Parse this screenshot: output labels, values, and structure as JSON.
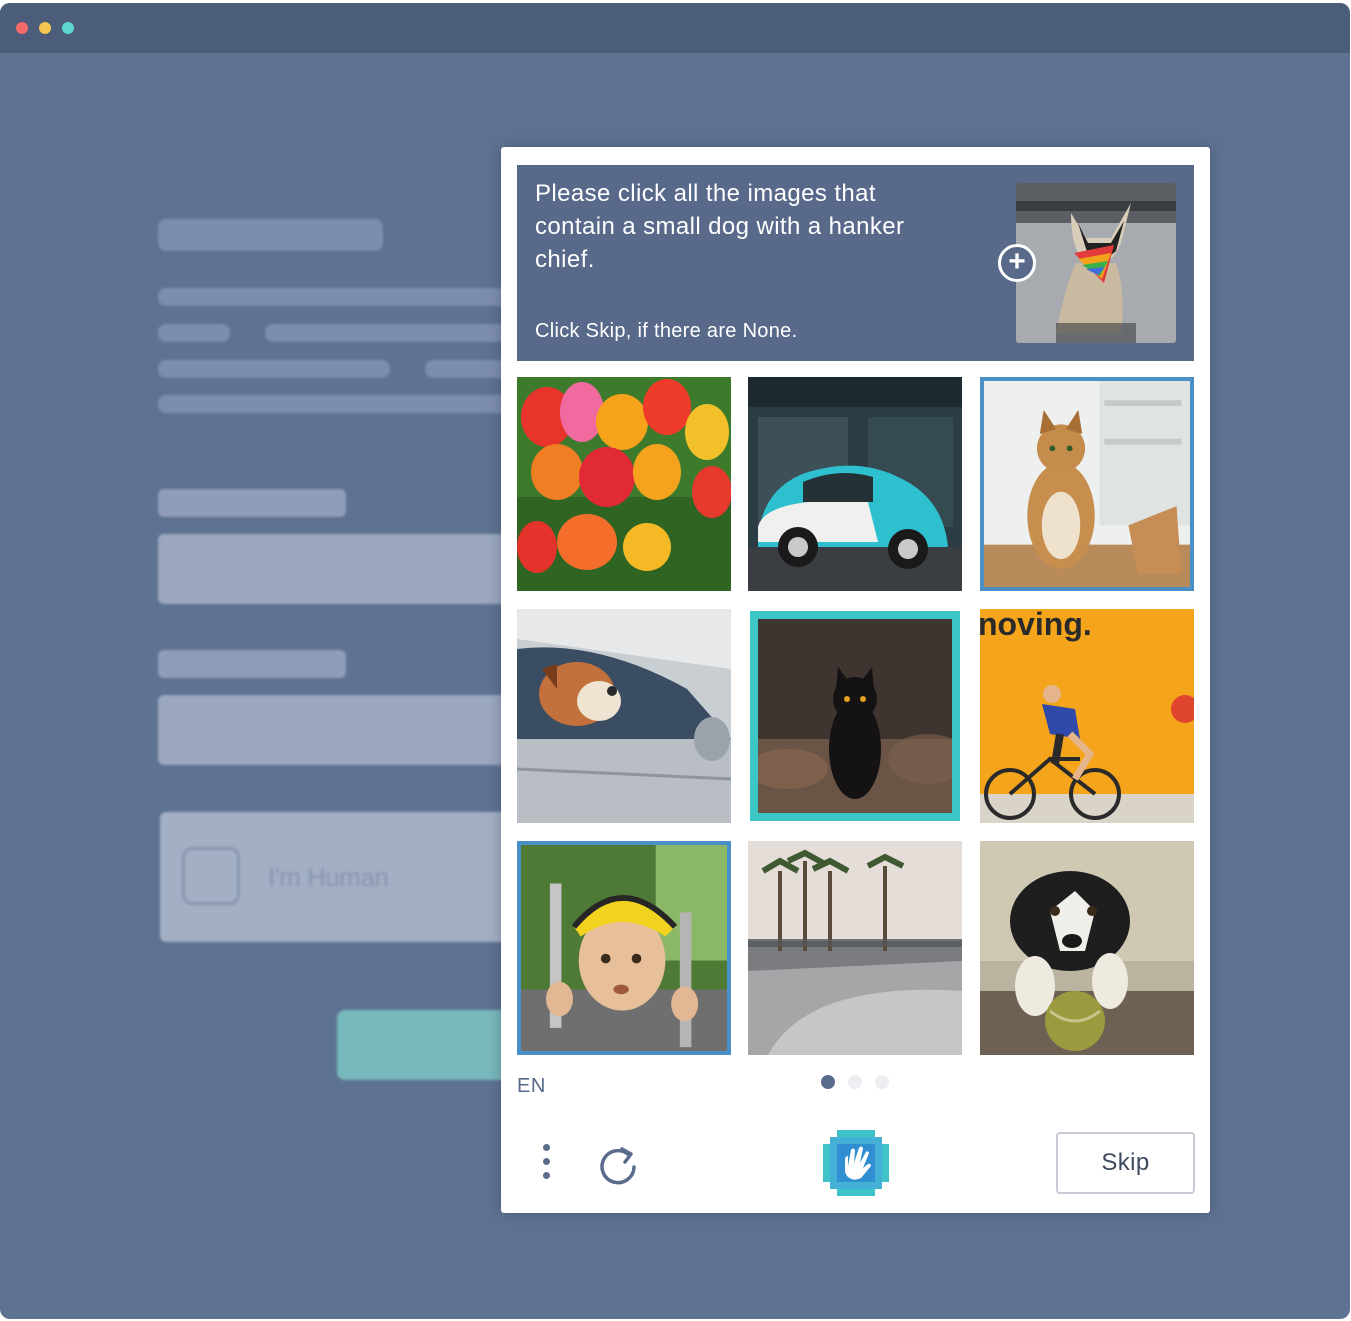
{
  "window": {
    "controls": [
      "close",
      "minimize",
      "maximize"
    ]
  },
  "background_form": {
    "checkbox_label": "I'm Human"
  },
  "captcha": {
    "prompt": "Please click all the images that contain a small dog with a hanker chief.",
    "hint": "Click Skip, if there are None.",
    "example_image": "dog-with-rainbow-bandana",
    "zoom_icon": "plus-circle-icon",
    "tiles": [
      {
        "subject": "tulips",
        "selected": false
      },
      {
        "subject": "blue-beetle-car",
        "selected": false
      },
      {
        "subject": "tabby-cat",
        "selected": true
      },
      {
        "subject": "bulldog-in-car",
        "selected": false
      },
      {
        "subject": "black-cat",
        "selected": true
      },
      {
        "subject": "cyclist-yellow-wall",
        "selected": false,
        "text": "noving."
      },
      {
        "subject": "boy-climbing-helmet",
        "selected": true
      },
      {
        "subject": "skatepark-palms",
        "selected": false
      },
      {
        "subject": "border-collie-ball",
        "selected": false
      }
    ],
    "language": "EN",
    "pages": {
      "total": 3,
      "current": 1
    },
    "skip_label": "Skip",
    "colors": {
      "prompt_bg": "#58698a",
      "select_blue": "#4a90c8",
      "select_teal": "#3cc6c6"
    }
  }
}
